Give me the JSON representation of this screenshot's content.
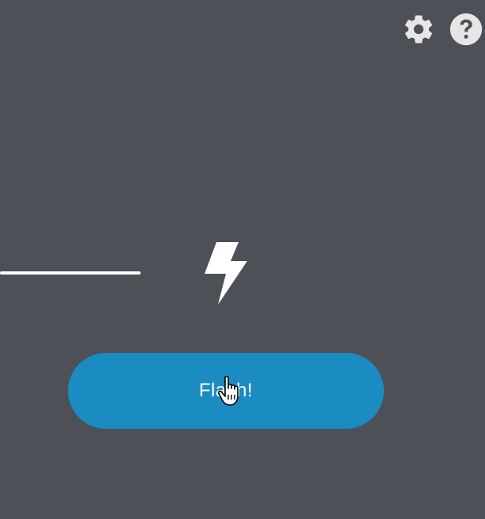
{
  "header": {
    "settings_icon": "gear-icon",
    "help_icon": "question-circle-icon"
  },
  "step": {
    "icon": "lightning-bolt-icon",
    "button_label": "Flash!"
  },
  "colors": {
    "background": "#4d5057",
    "button": "#1a8cc1",
    "icon": "#ffffff",
    "toolbar_icon": "#e6e6e6"
  }
}
